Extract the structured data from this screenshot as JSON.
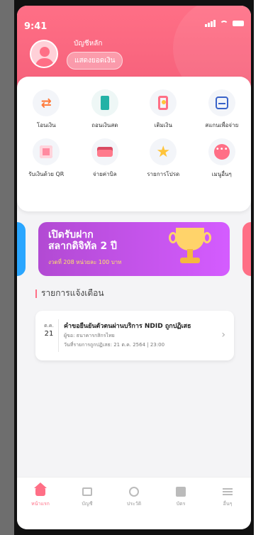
{
  "status": {
    "time": "9:41"
  },
  "header": {
    "account_label": "บัญชีหลัก",
    "show_balance_label": "แสดงยอดเงิน"
  },
  "menu": [
    {
      "label": "โอนเงิน",
      "icon": "transfer-icon"
    },
    {
      "label": "ถอนเงินสด",
      "icon": "withdraw-icon"
    },
    {
      "label": "เติมเงิน",
      "icon": "topup-icon"
    },
    {
      "label": "สแกนเพื่อจ่าย",
      "icon": "scan-icon"
    },
    {
      "label": "รับเงินด้วย QR",
      "icon": "qr-icon"
    },
    {
      "label": "จ่ายค่าบิล",
      "icon": "card-icon"
    },
    {
      "label": "รายการโปรด",
      "icon": "star-icon"
    },
    {
      "label": "เมนูอื่นๆ",
      "icon": "more-icon"
    }
  ],
  "banner": {
    "title_line1": "เปิดรับฝาก",
    "title_line2": "สลากดิจิทัล 2 ปี",
    "subtitle": "งวดที่ 208 หน่วยละ 100 บาท"
  },
  "notifications": {
    "section_title": "รายการแจ้งเตือน",
    "item": {
      "month": "ต.ค.",
      "day": "21",
      "title": "คำขอยืนยันตัวตนผ่านบริการ NDID ถูกปฏิเสธ",
      "line1": "ผู้ขอ: ธนาคารกสิกรไทย",
      "line2": "วันที่รายการถูกปฏิเสธ: 21 ต.ค. 2564 | 23:00"
    }
  },
  "tabs": [
    {
      "label": "หน้าแรก",
      "active": true
    },
    {
      "label": "บัญชี",
      "active": false
    },
    {
      "label": "ประวัติ",
      "active": false
    },
    {
      "label": "บัตร",
      "active": false
    },
    {
      "label": "อื่นๆ",
      "active": false
    }
  ],
  "colors": {
    "brand": "#ff6f86",
    "banner_purple": "#c04fe2"
  }
}
